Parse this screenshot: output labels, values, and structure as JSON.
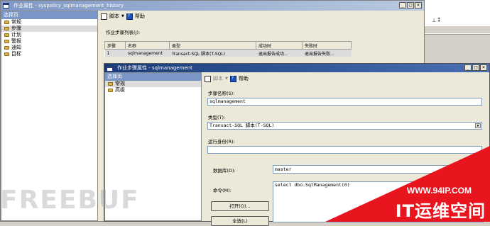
{
  "bg_window": {
    "title": "作业属性 - syspolicy_sqlmanagement_history",
    "left_header": "选择页",
    "nav": [
      "常规",
      "步骤",
      "计划",
      "警报",
      "通知",
      "目标"
    ],
    "toolbar": {
      "script": "脚本",
      "help": "帮助"
    },
    "list_label": "作业步骤列表(J):",
    "columns": [
      "步骤",
      "名称",
      "类型",
      "成功时",
      "失败时"
    ],
    "rows": [
      [
        "1",
        "sqlmanagement",
        "Transact-SQL 脚本(T-SQL)",
        "退出报告成功...",
        "退出报告失败..."
      ]
    ]
  },
  "fg_window": {
    "title": "作业步骤属性 - sqlmanagement",
    "left_header": "选择页",
    "nav": [
      "常规",
      "高级"
    ],
    "toolbar": {
      "script": "脚本",
      "help": "帮助"
    },
    "step_name_label": "步骤名称(S):",
    "step_name_value": "sqlmanagement",
    "type_label": "类型(T):",
    "type_value": "Transact-SQL 脚本(T-SQL)",
    "run_as_label": "运行身份(R):",
    "run_as_value": "",
    "database_label": "数据库(D):",
    "database_value": "master",
    "command_label": "命令(M):",
    "command_value": "select dbo.SqlManagement(0)",
    "open_button": "打开(O)...",
    "select_all_button": "全选(L)"
  },
  "watermark": "FREEBUF",
  "banner": {
    "url": "WWW.94IP.COM",
    "brand": "IT运维空间"
  }
}
